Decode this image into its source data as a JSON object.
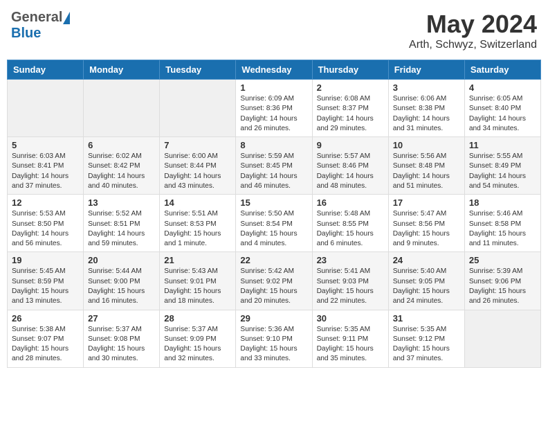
{
  "header": {
    "logo_general": "General",
    "logo_blue": "Blue",
    "title": "May 2024",
    "subtitle": "Arth, Schwyz, Switzerland"
  },
  "days_of_week": [
    "Sunday",
    "Monday",
    "Tuesday",
    "Wednesday",
    "Thursday",
    "Friday",
    "Saturday"
  ],
  "weeks": [
    [
      {
        "day": "",
        "content": ""
      },
      {
        "day": "",
        "content": ""
      },
      {
        "day": "",
        "content": ""
      },
      {
        "day": "1",
        "content": "Sunrise: 6:09 AM\nSunset: 8:36 PM\nDaylight: 14 hours\nand 26 minutes."
      },
      {
        "day": "2",
        "content": "Sunrise: 6:08 AM\nSunset: 8:37 PM\nDaylight: 14 hours\nand 29 minutes."
      },
      {
        "day": "3",
        "content": "Sunrise: 6:06 AM\nSunset: 8:38 PM\nDaylight: 14 hours\nand 31 minutes."
      },
      {
        "day": "4",
        "content": "Sunrise: 6:05 AM\nSunset: 8:40 PM\nDaylight: 14 hours\nand 34 minutes."
      }
    ],
    [
      {
        "day": "5",
        "content": "Sunrise: 6:03 AM\nSunset: 8:41 PM\nDaylight: 14 hours\nand 37 minutes."
      },
      {
        "day": "6",
        "content": "Sunrise: 6:02 AM\nSunset: 8:42 PM\nDaylight: 14 hours\nand 40 minutes."
      },
      {
        "day": "7",
        "content": "Sunrise: 6:00 AM\nSunset: 8:44 PM\nDaylight: 14 hours\nand 43 minutes."
      },
      {
        "day": "8",
        "content": "Sunrise: 5:59 AM\nSunset: 8:45 PM\nDaylight: 14 hours\nand 46 minutes."
      },
      {
        "day": "9",
        "content": "Sunrise: 5:57 AM\nSunset: 8:46 PM\nDaylight: 14 hours\nand 48 minutes."
      },
      {
        "day": "10",
        "content": "Sunrise: 5:56 AM\nSunset: 8:48 PM\nDaylight: 14 hours\nand 51 minutes."
      },
      {
        "day": "11",
        "content": "Sunrise: 5:55 AM\nSunset: 8:49 PM\nDaylight: 14 hours\nand 54 minutes."
      }
    ],
    [
      {
        "day": "12",
        "content": "Sunrise: 5:53 AM\nSunset: 8:50 PM\nDaylight: 14 hours\nand 56 minutes."
      },
      {
        "day": "13",
        "content": "Sunrise: 5:52 AM\nSunset: 8:51 PM\nDaylight: 14 hours\nand 59 minutes."
      },
      {
        "day": "14",
        "content": "Sunrise: 5:51 AM\nSunset: 8:53 PM\nDaylight: 15 hours\nand 1 minute."
      },
      {
        "day": "15",
        "content": "Sunrise: 5:50 AM\nSunset: 8:54 PM\nDaylight: 15 hours\nand 4 minutes."
      },
      {
        "day": "16",
        "content": "Sunrise: 5:48 AM\nSunset: 8:55 PM\nDaylight: 15 hours\nand 6 minutes."
      },
      {
        "day": "17",
        "content": "Sunrise: 5:47 AM\nSunset: 8:56 PM\nDaylight: 15 hours\nand 9 minutes."
      },
      {
        "day": "18",
        "content": "Sunrise: 5:46 AM\nSunset: 8:58 PM\nDaylight: 15 hours\nand 11 minutes."
      }
    ],
    [
      {
        "day": "19",
        "content": "Sunrise: 5:45 AM\nSunset: 8:59 PM\nDaylight: 15 hours\nand 13 minutes."
      },
      {
        "day": "20",
        "content": "Sunrise: 5:44 AM\nSunset: 9:00 PM\nDaylight: 15 hours\nand 16 minutes."
      },
      {
        "day": "21",
        "content": "Sunrise: 5:43 AM\nSunset: 9:01 PM\nDaylight: 15 hours\nand 18 minutes."
      },
      {
        "day": "22",
        "content": "Sunrise: 5:42 AM\nSunset: 9:02 PM\nDaylight: 15 hours\nand 20 minutes."
      },
      {
        "day": "23",
        "content": "Sunrise: 5:41 AM\nSunset: 9:03 PM\nDaylight: 15 hours\nand 22 minutes."
      },
      {
        "day": "24",
        "content": "Sunrise: 5:40 AM\nSunset: 9:05 PM\nDaylight: 15 hours\nand 24 minutes."
      },
      {
        "day": "25",
        "content": "Sunrise: 5:39 AM\nSunset: 9:06 PM\nDaylight: 15 hours\nand 26 minutes."
      }
    ],
    [
      {
        "day": "26",
        "content": "Sunrise: 5:38 AM\nSunset: 9:07 PM\nDaylight: 15 hours\nand 28 minutes."
      },
      {
        "day": "27",
        "content": "Sunrise: 5:37 AM\nSunset: 9:08 PM\nDaylight: 15 hours\nand 30 minutes."
      },
      {
        "day": "28",
        "content": "Sunrise: 5:37 AM\nSunset: 9:09 PM\nDaylight: 15 hours\nand 32 minutes."
      },
      {
        "day": "29",
        "content": "Sunrise: 5:36 AM\nSunset: 9:10 PM\nDaylight: 15 hours\nand 33 minutes."
      },
      {
        "day": "30",
        "content": "Sunrise: 5:35 AM\nSunset: 9:11 PM\nDaylight: 15 hours\nand 35 minutes."
      },
      {
        "day": "31",
        "content": "Sunrise: 5:35 AM\nSunset: 9:12 PM\nDaylight: 15 hours\nand 37 minutes."
      },
      {
        "day": "",
        "content": ""
      }
    ]
  ]
}
